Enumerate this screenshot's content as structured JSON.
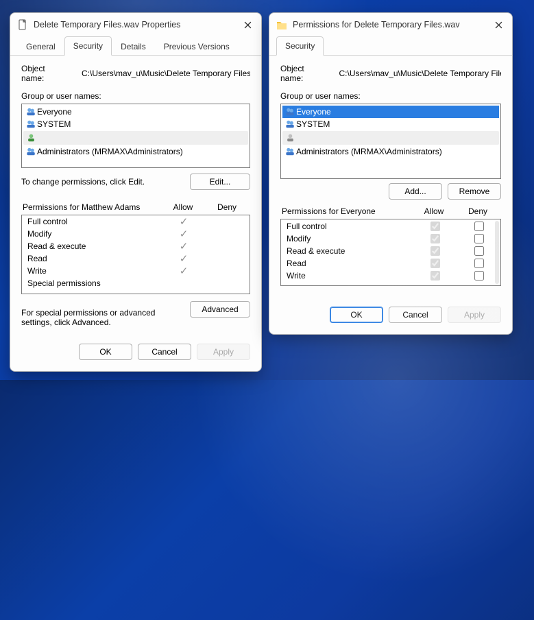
{
  "win1": {
    "title": "Delete Temporary Files.wav Properties",
    "tabs": {
      "general": "General",
      "security": "Security",
      "details": "Details",
      "previous": "Previous Versions"
    },
    "object_label": "Object name:",
    "object_path": "C:\\Users\\mav_u\\Music\\Delete Temporary Files.wa",
    "group_label": "Group or user names:",
    "principals": {
      "everyone": "Everyone",
      "system": "SYSTEM",
      "redacted": "",
      "admins": "Administrators (MRMAX\\Administrators)"
    },
    "change_note": "To change permissions, click Edit.",
    "edit_btn": "Edit...",
    "perm_for": "Permissions for Matthew Adams",
    "allow": "Allow",
    "deny": "Deny",
    "perms": [
      "Full control",
      "Modify",
      "Read & execute",
      "Read",
      "Write",
      "Special permissions"
    ],
    "adv_note": "For special permissions or advanced settings, click Advanced.",
    "advanced": "Advanced",
    "ok": "OK",
    "cancel": "Cancel",
    "apply": "Apply"
  },
  "win2": {
    "title": "Permissions for Delete Temporary Files.wav",
    "tab": "Security",
    "object_label": "Object name:",
    "object_path": "C:\\Users\\mav_u\\Music\\Delete Temporary Files.wa",
    "group_label": "Group or user names:",
    "principals": {
      "everyone": "Everyone",
      "system": "SYSTEM",
      "redacted": "",
      "admins": "Administrators (MRMAX\\Administrators)"
    },
    "add": "Add...",
    "remove": "Remove",
    "perm_for": "Permissions for Everyone",
    "allow": "Allow",
    "deny": "Deny",
    "perms": [
      "Full control",
      "Modify",
      "Read & execute",
      "Read",
      "Write"
    ],
    "ok": "OK",
    "cancel": "Cancel",
    "apply": "Apply"
  }
}
